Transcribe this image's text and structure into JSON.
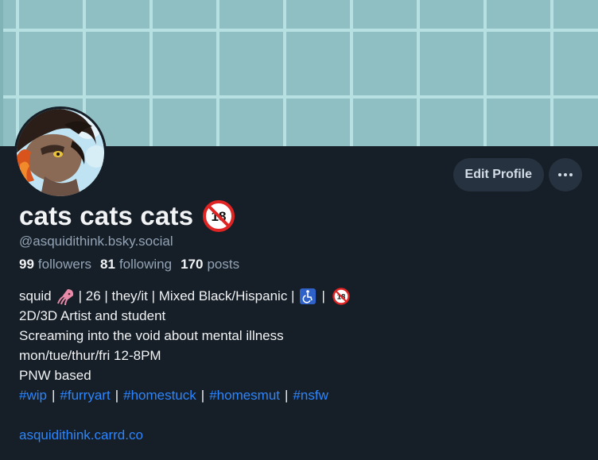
{
  "profile": {
    "display_name": "cats cats cats",
    "handle": "@asquidithink.bsky.social",
    "age_badge": "18"
  },
  "actions": {
    "edit_label": "Edit Profile",
    "more_icon": "ellipsis-icon"
  },
  "stats": {
    "followers_count": "99",
    "followers_label": "followers",
    "following_count": "81",
    "following_label": "following",
    "posts_count": "170",
    "posts_label": "posts"
  },
  "bio": {
    "line1_a": "squid",
    "line1_b": "| 26 | they/it | Mixed Black/Hispanic |",
    "line1_c": "|",
    "line2": "2D/3D Artist and student",
    "line3": "Screaming into the void about mental illness",
    "line4": "mon/tue/thur/fri 12-8PM",
    "line5": "PNW based",
    "hashtags": [
      "#wip",
      "#furryart",
      "#homestuck",
      "#homesmut",
      "#nsfw"
    ],
    "separator": "|",
    "website": "asquidithink.carrd.co"
  },
  "colors": {
    "background": "#161e27",
    "accent_link": "#2b86ff",
    "banner": "#8fbfc2",
    "muted_text": "#93a4b6"
  }
}
